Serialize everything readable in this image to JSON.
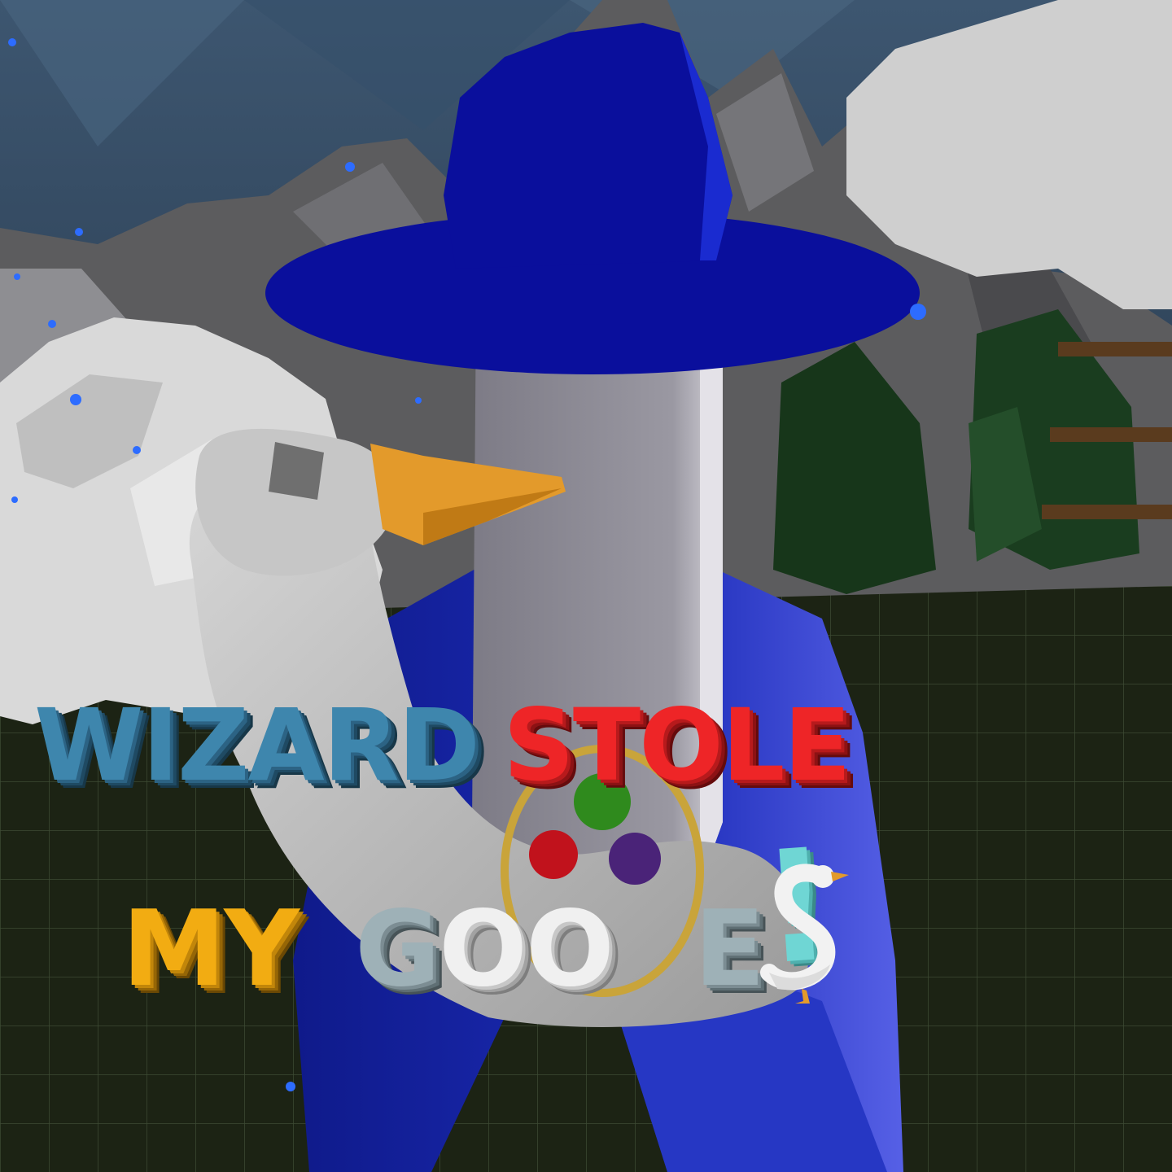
{
  "title": {
    "word1": "WIZARD",
    "word2": "STOLE",
    "word3": "MY",
    "word4a": "G",
    "word4b": "OO",
    "word4c": "E",
    "word4d": "!"
  },
  "colors": {
    "wizard_word": "#3e86ad",
    "stole_word": "#ee2527",
    "my_word": "#f2ac12",
    "goose_word": "#9eb1b7",
    "exclamation": "#6fd6d4",
    "wizard_hat": "#0a0f9c",
    "wizard_robe": "#1a2bb5"
  },
  "icons": [
    "goose-as-letter-s-icon"
  ]
}
